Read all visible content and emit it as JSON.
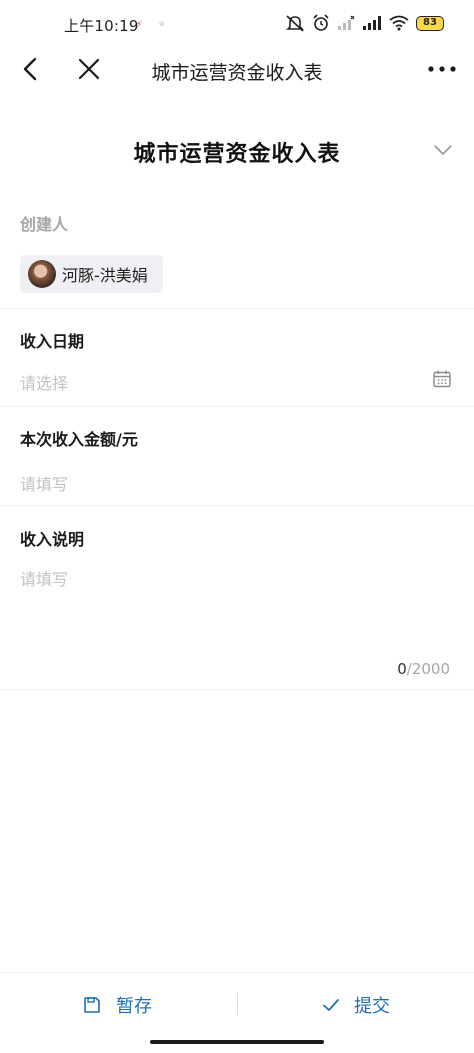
{
  "status_bar": {
    "time": "上午10:19",
    "mini_icon_1": "⚡",
    "mini_icon_2": "✧",
    "battery": "83"
  },
  "nav": {
    "title": "城市运营资金收入表",
    "back_icon": "chevron-left-icon",
    "close_icon": "close-icon",
    "more_icon": "more-icon"
  },
  "form": {
    "title": "城市运营资金收入表",
    "creator": {
      "label": "创建人",
      "name": "河豚-洪美娟"
    },
    "fields": [
      {
        "label": "收入日期",
        "placeholder": "请选择"
      },
      {
        "label": "本次收入金额/元",
        "placeholder": "请填写"
      },
      {
        "label": "收入说明",
        "placeholder": "请填写",
        "count": "0",
        "max": "/2000"
      }
    ]
  },
  "actions": {
    "save_draft": "暂存",
    "submit": "提交"
  },
  "colors": {
    "accent": "#1e6fb8",
    "placeholder": "#c2c2c2",
    "muted": "#a6a6a6"
  }
}
